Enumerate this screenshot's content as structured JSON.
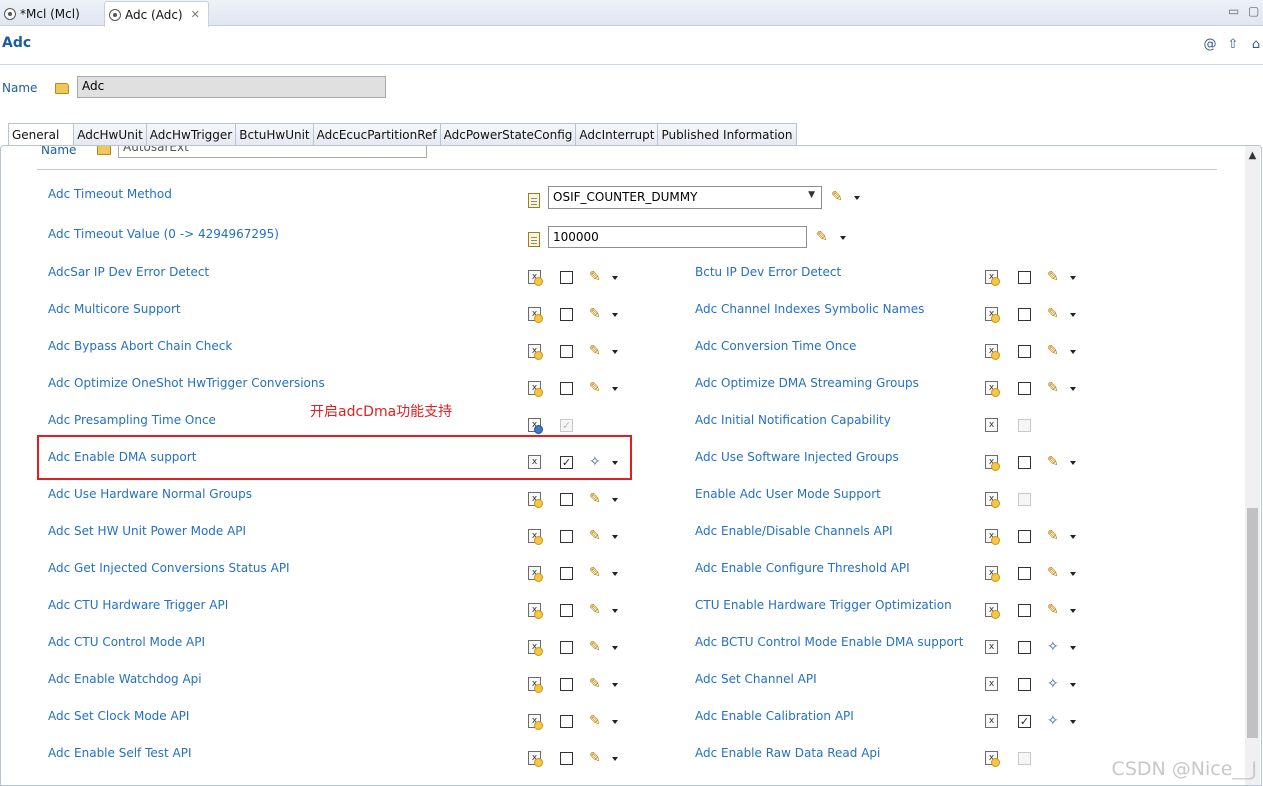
{
  "editor_tabs": [
    {
      "label": "*Mcl (Mcl)"
    },
    {
      "label": "Adc (Adc)"
    }
  ],
  "header": {
    "title": "Adc",
    "name_label": "Name",
    "name_value": "Adc",
    "icons": [
      "at-icon",
      "up-arrow-icon",
      "home-icon"
    ]
  },
  "section_tabs": [
    "General",
    "AdcHwUnit",
    "AdcHwTrigger",
    "BctuHwUnit",
    "AdcEcucPartitionRef",
    "AdcPowerStateConfig",
    "AdcInterrupt",
    "Published Information"
  ],
  "panel": {
    "partial_label": "Name",
    "partial_value": "AutosarExt",
    "timeout_method": {
      "label": "Adc Timeout Method",
      "value": "OSIF_COUNTER_DUMMY"
    },
    "timeout_value": {
      "label": "Adc Timeout Value (0 -> 4294967295)",
      "value": "100000"
    },
    "left_params": [
      {
        "label": "AdcSar IP Dev Error Detect",
        "checked": false,
        "enabled": true,
        "icon": "yellow",
        "edit": "pencil"
      },
      {
        "label": "Adc Multicore Support",
        "checked": false,
        "enabled": true,
        "icon": "yellow",
        "edit": "pencil"
      },
      {
        "label": "Adc Bypass Abort Chain Check",
        "checked": false,
        "enabled": true,
        "icon": "yellow",
        "edit": "pencil"
      },
      {
        "label": "Adc Optimize OneShot HwTrigger Conversions",
        "checked": false,
        "enabled": true,
        "icon": "yellow",
        "edit": "pencil"
      },
      {
        "label": "Adc Presampling Time Once",
        "checked": true,
        "enabled": false,
        "icon": "blue",
        "edit": "none"
      },
      {
        "label": "Adc Enable DMA support",
        "checked": true,
        "enabled": true,
        "icon": "plain",
        "edit": "wand"
      },
      {
        "label": "Adc Use Hardware Normal Groups",
        "checked": false,
        "enabled": true,
        "icon": "yellow",
        "edit": "pencil"
      },
      {
        "label": "Adc Set HW Unit Power Mode API",
        "checked": false,
        "enabled": true,
        "icon": "yellow",
        "edit": "pencil"
      },
      {
        "label": "Adc Get Injected Conversions Status API",
        "checked": false,
        "enabled": true,
        "icon": "yellow",
        "edit": "pencil"
      },
      {
        "label": "Adc CTU Hardware Trigger API",
        "checked": false,
        "enabled": true,
        "icon": "yellow",
        "edit": "pencil"
      },
      {
        "label": "Adc CTU Control Mode API",
        "checked": false,
        "enabled": true,
        "icon": "yellow",
        "edit": "pencil"
      },
      {
        "label": "Adc Enable Watchdog Api",
        "checked": false,
        "enabled": true,
        "icon": "yellow",
        "edit": "pencil"
      },
      {
        "label": "Adc Set Clock Mode API",
        "checked": false,
        "enabled": true,
        "icon": "yellow",
        "edit": "pencil"
      },
      {
        "label": "Adc Enable Self Test API",
        "checked": false,
        "enabled": true,
        "icon": "yellow",
        "edit": "pencil"
      }
    ],
    "right_params": [
      {
        "label": "Bctu IP Dev Error Detect",
        "checked": false,
        "enabled": true,
        "icon": "yellow",
        "edit": "pencil"
      },
      {
        "label": "Adc Channel Indexes Symbolic Names",
        "checked": false,
        "enabled": true,
        "icon": "yellow",
        "edit": "pencil"
      },
      {
        "label": "Adc Conversion Time Once",
        "checked": false,
        "enabled": true,
        "icon": "yellow",
        "edit": "pencil"
      },
      {
        "label": "Adc Optimize DMA Streaming Groups",
        "checked": false,
        "enabled": true,
        "icon": "yellow",
        "edit": "pencil"
      },
      {
        "label": "Adc Initial Notification Capability",
        "checked": false,
        "enabled": false,
        "icon": "plain",
        "edit": "none"
      },
      {
        "label": "Adc Use Software Injected Groups",
        "checked": false,
        "enabled": true,
        "icon": "yellow",
        "edit": "pencil"
      },
      {
        "label": "Enable Adc User Mode Support",
        "checked": false,
        "enabled": false,
        "icon": "yellow",
        "edit": "none"
      },
      {
        "label": "Adc Enable/Disable Channels API",
        "checked": false,
        "enabled": true,
        "icon": "yellow",
        "edit": "pencil"
      },
      {
        "label": "Adc Enable Configure Threshold API",
        "checked": false,
        "enabled": true,
        "icon": "yellow",
        "edit": "pencil"
      },
      {
        "label": "CTU Enable Hardware Trigger Optimization",
        "checked": false,
        "enabled": true,
        "icon": "yellow",
        "edit": "pencil"
      },
      {
        "label": "Adc BCTU Control Mode Enable DMA support",
        "checked": false,
        "enabled": true,
        "icon": "plain",
        "edit": "wand"
      },
      {
        "label": "Adc Set Channel API",
        "checked": false,
        "enabled": true,
        "icon": "plain",
        "edit": "wand"
      },
      {
        "label": "Adc Enable Calibration API",
        "checked": true,
        "enabled": true,
        "icon": "plain",
        "edit": "wand"
      },
      {
        "label": "Adc Enable Raw Data Read Api",
        "checked": false,
        "enabled": false,
        "icon": "yellow",
        "edit": "none"
      }
    ]
  },
  "annotation": {
    "text": "开启adcDma功能支持",
    "color": "#e02020"
  },
  "watermark": "CSDN @Nice__J",
  "colors": {
    "label_blue": "#2470c2",
    "title_blue": "#1a5c9e",
    "annotation_red": "#e02020"
  }
}
